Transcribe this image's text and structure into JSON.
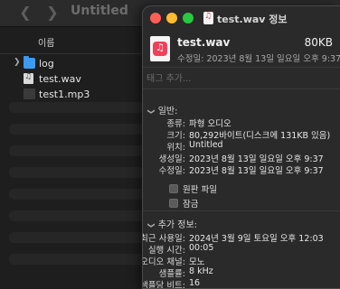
{
  "finder": {
    "title": "Untitled",
    "column_name": "이름",
    "files": [
      {
        "name": "log",
        "kind": "folder",
        "expandable": true
      },
      {
        "name": "test.wav",
        "kind": "audio"
      },
      {
        "name": "test1.mp3",
        "kind": "audio"
      }
    ]
  },
  "info": {
    "title": "test.wav 정보",
    "file_name": "test.wav",
    "file_size": "80KB",
    "modified_line": "수정일: 2023년 8월 13일 일요일 오후 9:37",
    "tag_placeholder": "태그 추가...",
    "general": {
      "header": "일반:",
      "rows": [
        {
          "key": "종류:",
          "value": "파형 오디오"
        },
        {
          "key": "크기:",
          "value": "80,292바이트(디스크에 131KB 있음)"
        },
        {
          "key": "위치:",
          "value": "Untitled"
        },
        {
          "key": "생성일:",
          "value": "2023년 8월 13일 일요일 오후 9:37"
        },
        {
          "key": "수정일:",
          "value": "2023년 8월 13일 일요일 오후 9:37"
        }
      ],
      "stationery_label": "원판 파일",
      "locked_label": "잠금"
    },
    "more": {
      "header": "추가 정보:",
      "rows": [
        {
          "key": "최근 사용일:",
          "value": "2024년 3월 9일 토요일 오후 12:03"
        },
        {
          "key": "실행 시간:",
          "value": "00:05"
        },
        {
          "key": "오디오 채널:",
          "value": "모노"
        },
        {
          "key": "샘플률:",
          "value": "8 kHz"
        },
        {
          "key": "샘플당 비트:",
          "value": "16"
        }
      ]
    }
  }
}
